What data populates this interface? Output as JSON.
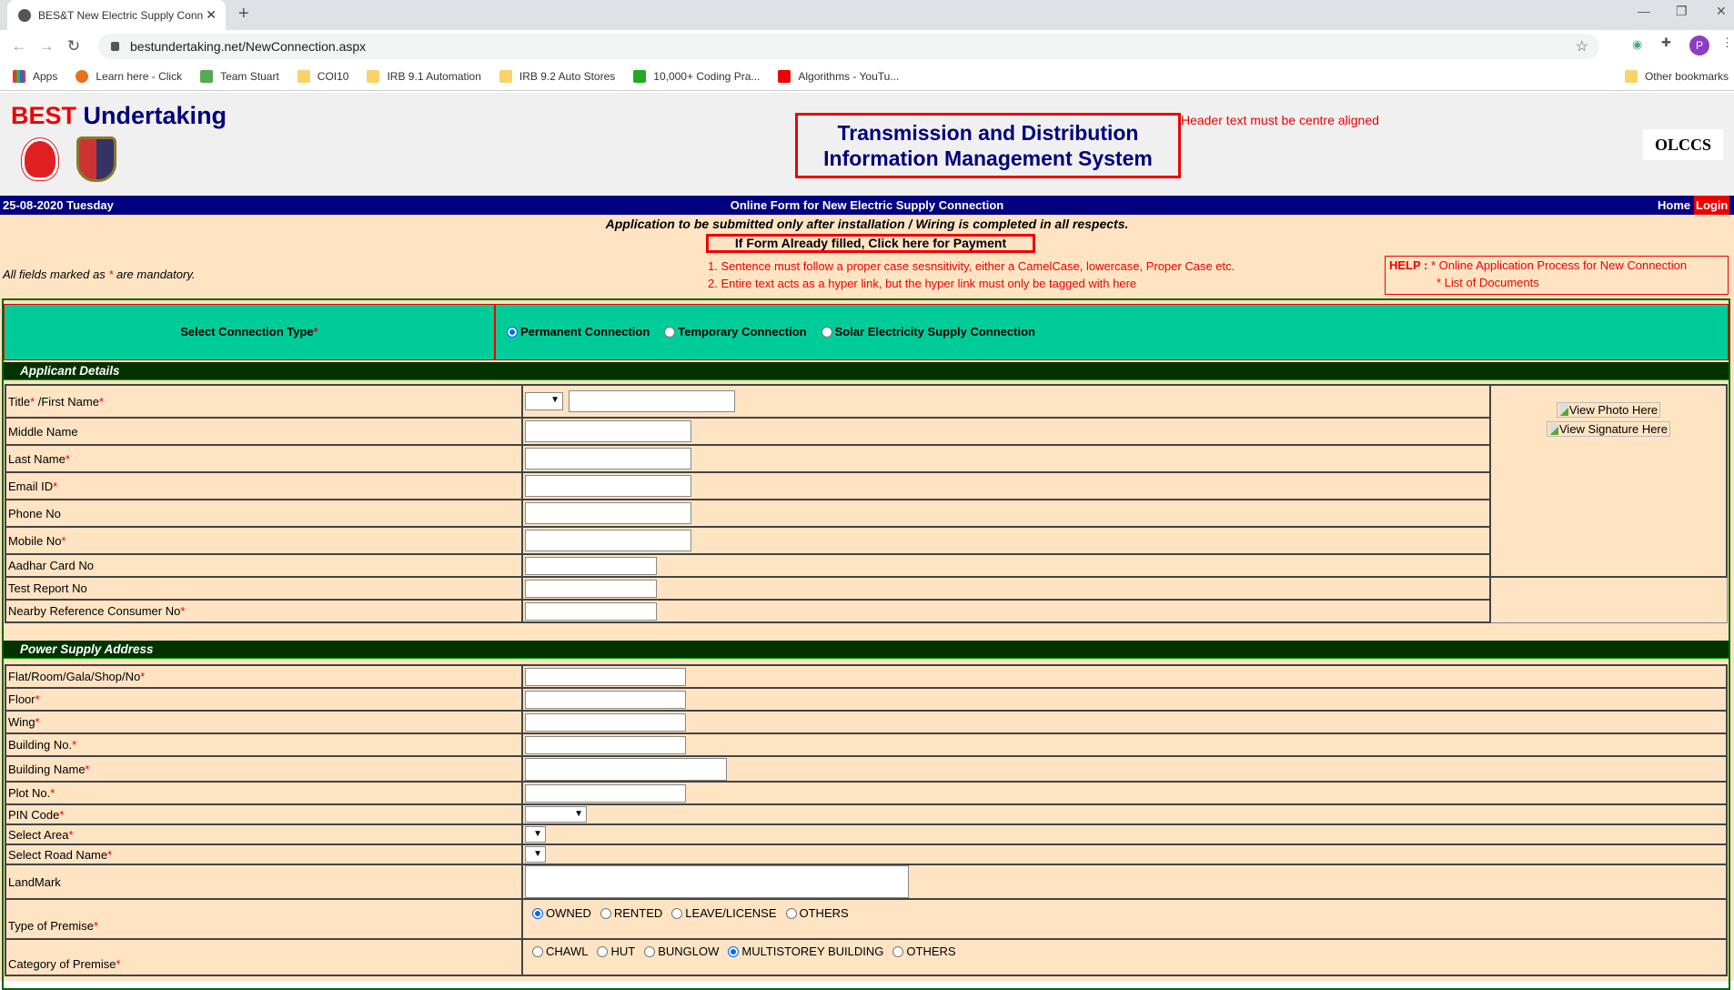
{
  "browser": {
    "tab_title": "BES&T New Electric Supply Conn",
    "url": "bestundertaking.net/NewConnection.aspx",
    "bookmarks": [
      "Apps",
      "Learn here - Click",
      "Team Stuart",
      "COI10",
      "IRB 9.1 Automation",
      "IRB 9.2 Auto Stores",
      "10,000+ Coding Pra...",
      "Algorithms - YouTu..."
    ],
    "other_bookmarks": "Other bookmarks",
    "profile_initial": "P"
  },
  "header": {
    "brand_red": "BEST",
    "brand_blue": "Undertaking",
    "title_line1": "Transmission and Distribution",
    "title_line2": "Information Management System",
    "annotation": "Header text must be centre aligned",
    "olccs": "OLCCS"
  },
  "bluebar": {
    "date": "25-08-2020 Tuesday",
    "title": "Online Form for New Electric Supply Connection",
    "home": "Home",
    "login": "Login"
  },
  "info": {
    "application_note": "Application to be submitted only after installation / Wiring is completed in all respects.",
    "payment_link": "If Form Already filled, Click here for Payment",
    "mandatory_pre": "All fields marked as ",
    "mandatory_star": "*",
    "mandatory_post": " are mandatory.",
    "note1": "1. Sentence must follow a proper case sesnsitivity, either a CamelCase, lowercase, Proper Case etc.",
    "note2": "2. Entire text acts as a hyper link, but the hyper link must only be tagged with here",
    "help_label": "HELP :",
    "help_link1": "* Online Application Process for New Connection",
    "help_link2": "* List of Documents"
  },
  "connection": {
    "label": "Select Connection Type",
    "options": [
      {
        "label": "Permanent Connection",
        "checked": true
      },
      {
        "label": "Temporary Connection",
        "checked": false
      },
      {
        "label": "Solar Electricity Supply Connection",
        "checked": false
      }
    ]
  },
  "applicant": {
    "section_title": "Applicant Details",
    "view_photo": "View Photo Here",
    "view_signature": "View Signature Here",
    "rows": [
      {
        "label": "Title",
        "label2": " /First Name",
        "req": true
      },
      {
        "label": "Middle Name",
        "req": false
      },
      {
        "label": "Last Name",
        "req": true
      },
      {
        "label": "Email ID",
        "req": true
      },
      {
        "label": "Phone No",
        "req": false
      },
      {
        "label": "Mobile No",
        "req": true
      },
      {
        "label": "Aadhar Card No",
        "req": false
      },
      {
        "label": "Test Report No",
        "req": false
      },
      {
        "label": "Nearby Reference Consumer No",
        "req": true
      }
    ]
  },
  "address": {
    "section_title": "Power Supply Address",
    "rows": [
      {
        "label": "Flat/Room/Gala/Shop/No",
        "req": true
      },
      {
        "label": "Floor",
        "req": true
      },
      {
        "label": "Wing",
        "req": true
      },
      {
        "label": "Building No.",
        "req": true
      },
      {
        "label": "Building Name",
        "req": true
      },
      {
        "label": "Plot No.",
        "req": true
      },
      {
        "label": "PIN Code",
        "req": true
      },
      {
        "label": "Select Area",
        "req": true
      },
      {
        "label": "Select Road Name",
        "req": true
      },
      {
        "label": "LandMark",
        "req": false
      },
      {
        "label": "Type of Premise",
        "req": true
      },
      {
        "label": "Category of Premise",
        "req": true
      }
    ],
    "premise_types": [
      {
        "label": "OWNED",
        "checked": true
      },
      {
        "label": "RENTED",
        "checked": false
      },
      {
        "label": "LEAVE/LICENSE",
        "checked": false
      },
      {
        "label": "OTHERS",
        "checked": false
      }
    ],
    "premise_categories": [
      {
        "label": "CHAWL",
        "checked": false
      },
      {
        "label": "HUT",
        "checked": false
      },
      {
        "label": "BUNGLOW",
        "checked": false
      },
      {
        "label": "MULTISTOREY BUILDING",
        "checked": true
      },
      {
        "label": "OTHERS",
        "checked": false
      }
    ]
  },
  "colors": {
    "nav_blue": "#000080",
    "accent_red": "#ee0000",
    "connection_bg": "#00cc99",
    "section_bg": "#003300",
    "form_bg": "#ffe4c4"
  }
}
